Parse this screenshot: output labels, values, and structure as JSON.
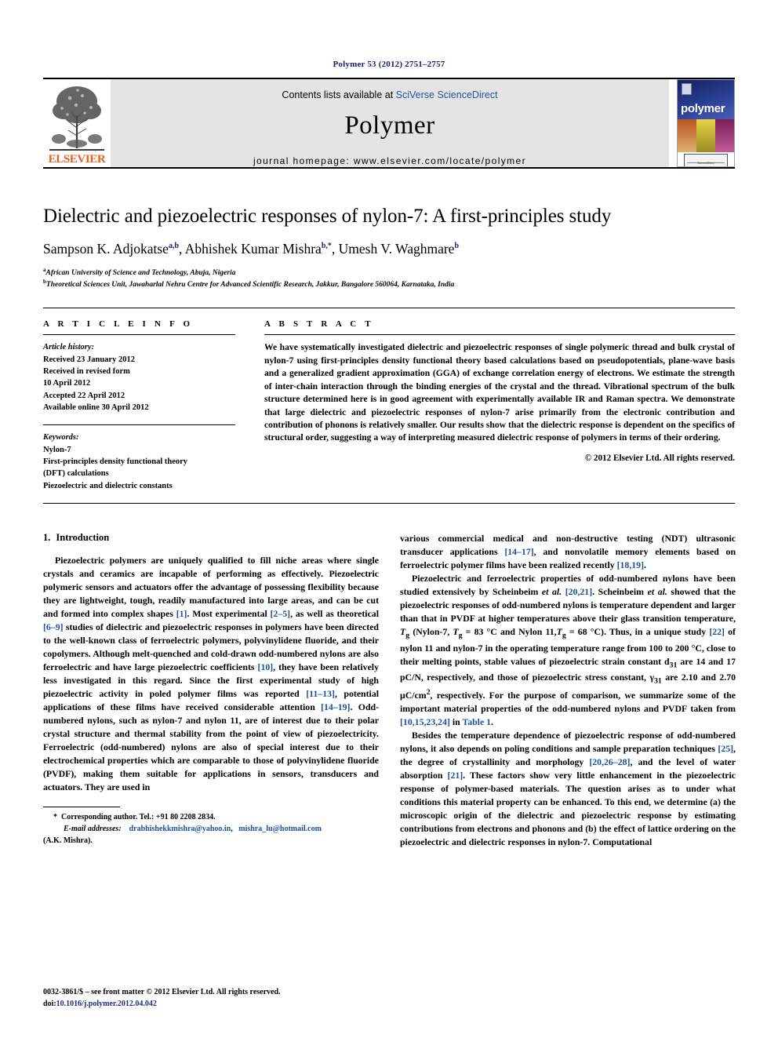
{
  "running_head": "Polymer 53 (2012) 2751–2757",
  "masthead": {
    "publisher_name": "ELSEVIER",
    "contents_prefix": "Contents lists available at ",
    "contents_link": "SciVerse ScienceDirect",
    "journal_name": "Polymer",
    "homepage": "journal homepage: www.elsevier.com/locate/polymer",
    "cover_title": "polymer"
  },
  "article": {
    "title": "Dielectric and piezoelectric responses of nylon-7: A first-principles study",
    "authors": [
      {
        "name": "Sampson K. Adjokatse",
        "marks": "a,b",
        "sep": ", "
      },
      {
        "name": "Abhishek Kumar Mishra",
        "marks": "b,*",
        "sep": ", "
      },
      {
        "name": "Umesh V. Waghmare",
        "marks": "b",
        "sep": ""
      }
    ],
    "affiliations": [
      {
        "mark": "a",
        "text": "African University of Science and Technology, Abuja, Nigeria"
      },
      {
        "mark": "b",
        "text": "Theoretical Sciences Unit, Jawaharlal Nehru Centre for Advanced Scientific Research, Jakkur, Bangalore 560064, Karnataka, India"
      }
    ]
  },
  "info": {
    "heading": "A R T I C L E  I N F O",
    "history_label": "Article history:",
    "history": [
      "Received 23 January 2012",
      "Received in revised form",
      "10 April 2012",
      "Accepted 22 April 2012",
      "Available online 30 April 2012"
    ],
    "keywords_label": "Keywords:",
    "keywords": [
      "Nylon-7",
      "First-principles density functional theory",
      "(DFT) calculations",
      "Piezoelectric and dielectric constants"
    ]
  },
  "abstract": {
    "heading": "A B S T R A C T",
    "text": "We have systematically investigated dielectric and piezoelectric responses of single polymeric thread and bulk crystal of nylon-7 using first-principles density functional theory based calculations based on pseudopotentials, plane-wave basis and a generalized gradient approximation (GGA) of exchange correlation energy of electrons. We estimate the strength of inter-chain interaction through the binding energies of the crystal and the thread. Vibrational spectrum of the bulk structure determined here is in good agreement with experimentally available IR and Raman spectra. We demonstrate that large dielectric and piezoelectric responses of nylon-7 arise primarily from the electronic contribution and contribution of phonons is relatively smaller. Our results show that the dielectric response is dependent on the specifics of structural order, suggesting a way of interpreting measured dielectric response of polymers in terms of their ordering.",
    "copyright": "© 2012 Elsevier Ltd. All rights reserved."
  },
  "section": {
    "number": "1.",
    "title": "Introduction"
  },
  "body": {
    "left_paragraph_1_part1": "Piezoelectric polymers are uniquely qualified to fill niche areas where single crystals and ceramics are incapable of performing as effectively. Piezoelectric polymeric sensors and actuators offer the advantage of possessing flexibility because they are lightweight, tough, readily manufactured into large areas, and can be cut and formed into complex shapes ",
    "ref_1": "[1]",
    "left_paragraph_1_part2": ". Most experimental ",
    "ref_2_5": "[2–5]",
    "left_paragraph_1_part3": ", as well as theoretical ",
    "ref_6_9": "[6–9]",
    "left_paragraph_1_part4": " studies of dielectric and piezoelectric responses in polymers have been directed to the well-known class of ferroelectric polymers, polyvinylidene fluoride, and their copolymers. Although melt-quenched and cold-drawn odd-numbered nylons are also ferroelectric and have large piezoelectric coefficients ",
    "ref_10": "[10]",
    "left_paragraph_1_part5": ", they have been relatively less investigated in this regard. Since the first experimental study of high piezoelectric activity in poled polymer films was reported ",
    "ref_11_13": "[11–13]",
    "left_paragraph_1_part6": ", potential applications of these films have received considerable attention ",
    "ref_14_19": "[14–19]",
    "left_paragraph_1_part7": ". Odd-numbered nylons, such as nylon-7 and nylon 11, are of interest due to their polar crystal structure and thermal stability from the point of view of piezoelectricity. Ferroelectric (odd-numbered) nylons are also of special interest due to their electrochemical properties which are comparable to those of polyvinylidene fluoride (PVDF), making them suitable for applications in sensors, transducers and actuators. They are used in",
    "right_paragraph_1_part1": "various commercial medical and non-destructive testing (NDT) ultrasonic transducer applications ",
    "ref_14_17": "[14–17]",
    "right_paragraph_1_part2": ", and nonvolatile memory elements based on ferroelectric polymer films have been realized recently ",
    "ref_18_19": "[18,19]",
    "right_paragraph_1_part3": ".",
    "right_paragraph_2_part1": "Piezoelectric and ferroelectric properties of odd-numbered nylons have been studied extensively by Scheinbeim ",
    "etal_1": "et al.",
    "right_paragraph_2_part2": " ",
    "ref_20_21": "[20,21]",
    "right_paragraph_2_part3": ". Scheinbeim ",
    "etal_2": "et al.",
    "right_paragraph_2_part4": " showed that the piezoelectric responses of odd-numbered nylons is temperature dependent and larger than that in PVDF at higher temperatures above their glass transition temperature, ",
    "tg1": "T",
    "tg1sub": "g",
    "right_paragraph_2_part5": " (Nylon-7, ",
    "tg2": "T",
    "tg2sub": "g",
    "right_paragraph_2_part6": " = 83 °C and Nylon 11,",
    "tg3": "T",
    "tg3sub": "g",
    "right_paragraph_2_part7": " = 68 °C). Thus, in a unique study ",
    "ref_22": "[22]",
    "right_paragraph_2_part8": " of nylon 11 and nylon-7 in the operating temperature range from 100 to 200 °C, close to their melting points, stable values of piezoelectric strain constant d",
    "d31sub": "31",
    "right_paragraph_2_part9": " are 14 and 17 pC/N, respectively, and those of piezoelectric stress constant, γ",
    "g31sub": "31",
    "right_paragraph_2_part10": " are 2.10 and 2.70 μC/cm",
    "sup2": "2",
    "right_paragraph_2_part11": ", respectively. For the purpose of comparison, we summarize some of the important material properties of the odd-numbered nylons and PVDF taken from ",
    "ref_10_15_23_24": "[10,15,23,24]",
    "right_paragraph_2_part12": " in ",
    "table_link": "Table 1",
    "right_paragraph_2_part13": ".",
    "right_paragraph_3_part1": "Besides the temperature dependence of piezoelectric response of odd-numbered nylons, it also depends on poling conditions and sample preparation techniques ",
    "ref_25": "[25]",
    "right_paragraph_3_part2": ", the degree of crystallinity and morphology ",
    "ref_20_26_28": "[20,26–28]",
    "right_paragraph_3_part3": ", and the level of water absorption ",
    "ref_21": "[21]",
    "right_paragraph_3_part4": ". These factors show very little enhancement in the piezoelectric response of polymer-based materials. The question arises as to under what conditions this material property can be enhanced. To this end, we determine (a) the microscopic origin of the dielectric and piezoelectric response by estimating contributions from electrons and phonons and (b) the effect of lattice ordering on the piezoelectric and dielectric responses in nylon-7. Computational"
  },
  "footnote": {
    "star": "*",
    "corresponding": "Corresponding author. Tel.: +91 80 2208 2834.",
    "email_label": "E-mail addresses:",
    "email1": "drabhishekkmishra@yahoo.in",
    "email_sep": ",",
    "email2": "mishra_lu@hotmail.com",
    "email_attrib": "(A.K. Mishra)."
  },
  "footer": {
    "issn_line": "0032-3861/$ – see front matter © 2012 Elsevier Ltd. All rights reserved.",
    "doi_label": "doi:",
    "doi_value": "10.1016/j.polymer.2012.04.042"
  },
  "colors": {
    "link_blue": "#1a4f9c",
    "header_navy": "#1a1a6e",
    "elsevier_orange": "#E8601C",
    "masthead_gray": "#e4e4e4",
    "cover_navy": "#20327a"
  }
}
